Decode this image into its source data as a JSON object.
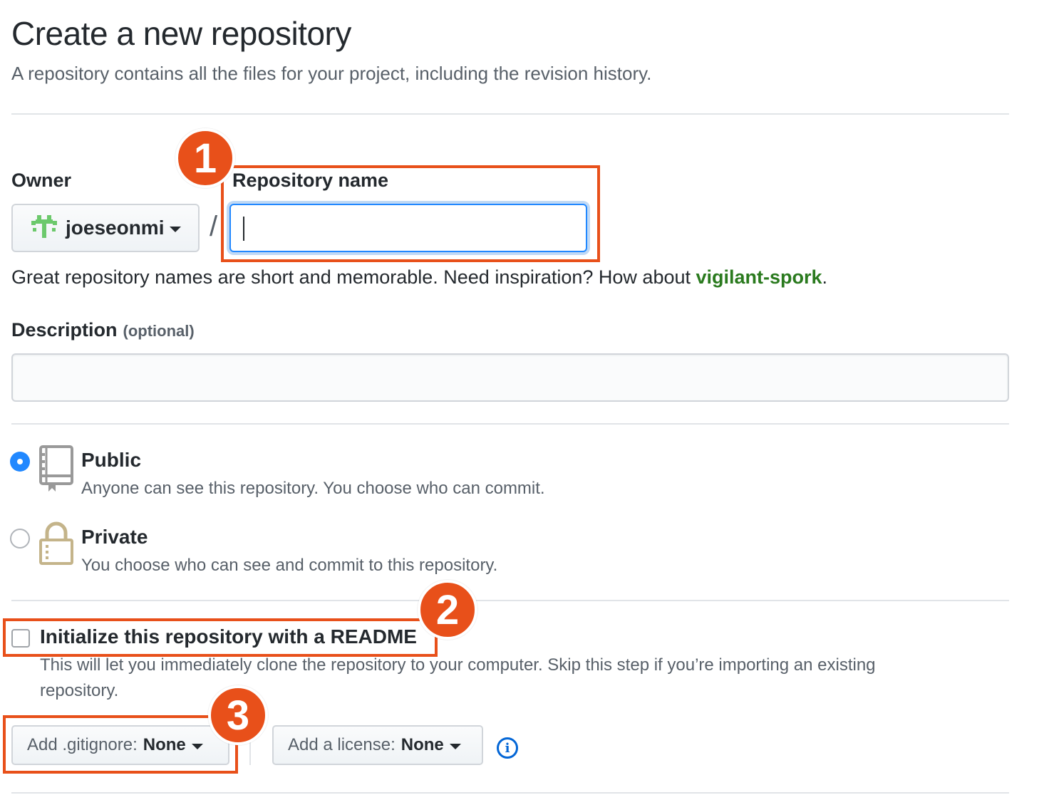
{
  "header": {
    "title": "Create a new repository",
    "subtitle": "A repository contains all the files for your project, including the revision history."
  },
  "owner": {
    "label": "Owner",
    "value": "joeseonmi",
    "avatar_color": "#6cc96c"
  },
  "separator": "/",
  "repo_name": {
    "label": "Repository name",
    "value": "",
    "placeholder": ""
  },
  "hint": {
    "prefix": "Great repository names are short and memorable. Need inspiration? How about ",
    "suggestion": "vigilant-spork",
    "suffix": "."
  },
  "description": {
    "label": "Description",
    "optional": "(optional)",
    "value": ""
  },
  "visibility": {
    "selected": "public",
    "public": {
      "title": "Public",
      "desc": "Anyone can see this repository. You choose who can commit.",
      "icon": "repo-book-icon"
    },
    "private": {
      "title": "Private",
      "desc": "You choose who can see and commit to this repository.",
      "icon": "lock-icon"
    }
  },
  "readme": {
    "checked": false,
    "label": "Initialize this repository with a README",
    "desc_line1": "This will let you immediately clone the repository to your computer. Skip this step if you’re importing an existing",
    "desc_line2": "repository."
  },
  "gitignore": {
    "prefix": "Add .gitignore:",
    "value": "None"
  },
  "license": {
    "prefix": "Add a license:",
    "value": "None"
  },
  "info_icon": "i",
  "annotations": {
    "color": "#e8501a",
    "labels": [
      "1",
      "2",
      "3"
    ]
  },
  "colors": {
    "accent_blue": "#2188ff",
    "suggestion_green": "#2a7a1e"
  }
}
